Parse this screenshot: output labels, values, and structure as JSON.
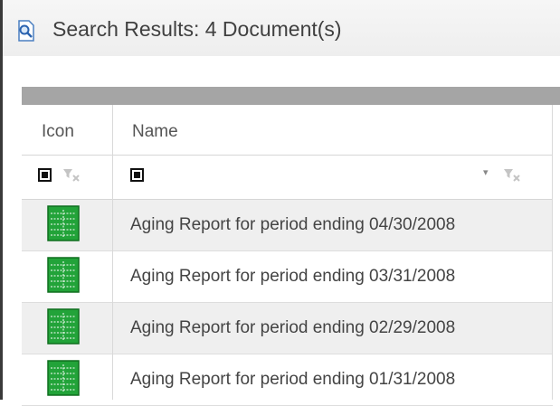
{
  "panel": {
    "title": "Search Results: 4 Document(s)"
  },
  "grid": {
    "columns": [
      "Icon",
      "Name"
    ],
    "rows": [
      {
        "icon": "spreadsheet-icon",
        "name": "Aging Report for period ending 04/30/2008"
      },
      {
        "icon": "spreadsheet-icon",
        "name": "Aging Report for period ending 03/31/2008"
      },
      {
        "icon": "spreadsheet-icon",
        "name": "Aging Report for period ending 02/29/2008"
      },
      {
        "icon": "spreadsheet-icon",
        "name": "Aging Report for period ending 01/31/2008"
      }
    ]
  },
  "icons": {
    "header": "search-document-icon",
    "filter": "clear-filter-icon",
    "checkbox": "checkbox-icon",
    "dropdown": "dropdown-arrow-icon"
  },
  "colors": {
    "header_bg": "#eeeeee",
    "separator_bar": "#a5a5a5",
    "alt_row": "#efefef",
    "spreadsheet_green": "#22a339"
  }
}
